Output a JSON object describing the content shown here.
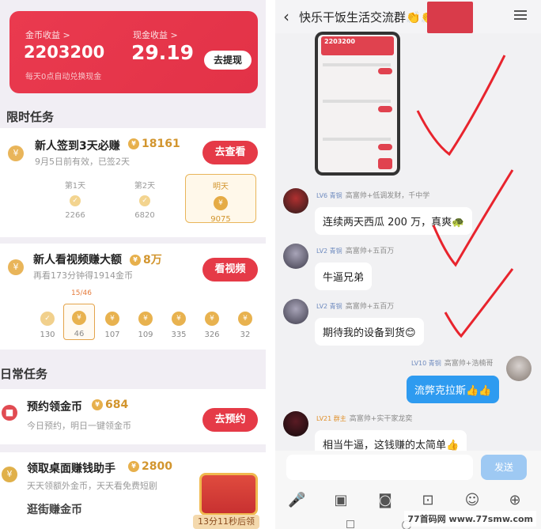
{
  "left": {
    "coin_income_label": "金币收益 >",
    "coin_income_value": "2203200",
    "cash_income_label": "现金收益 >",
    "cash_income_value": "29.19",
    "auto_exchange_note": "每天0点自动兑换现金",
    "withdraw_label": "去提现",
    "limited_tasks_title": "限时任务",
    "daily_tasks_title": "日常任务",
    "signin": {
      "title": "新人签到3天必赚",
      "amount": "18161",
      "subtitle": "9月5日前有效，已签2天",
      "button": "去查看",
      "days": [
        {
          "label": "第1天",
          "value": "2266"
        },
        {
          "label": "第2天",
          "value": "6820"
        },
        {
          "label": "明天",
          "value": "9075"
        }
      ]
    },
    "video": {
      "title": "新人看视频赚大额",
      "amount": "8万",
      "subtitle": "再看173分钟得1914金币",
      "button": "看视频",
      "progress": "15/46",
      "steps": [
        "130",
        "46",
        "107",
        "109",
        "335",
        "326",
        "32"
      ]
    },
    "reserve": {
      "title": "预约领金币",
      "amount": "684",
      "subtitle": "今日预约，明日一键领金币",
      "button": "去预约"
    },
    "desktop": {
      "title": "领取桌面赚钱助手",
      "amount": "2800",
      "subtitle": "天天领额外金币，天天看免费短剧"
    },
    "bottom_partial": "逛街赚金币",
    "timer": "13分11秒后领"
  },
  "right": {
    "title": "快乐干饭生活交流群👏👏",
    "screenshot_value": "2203200",
    "messages": [
      {
        "level": "LV6 青铜",
        "meta": "高富帅+低调发财，千中学",
        "text": "连续两天西瓜 200 万，真爽🐢"
      },
      {
        "level": "LV2 青铜",
        "meta": "高富帅+五百万",
        "text": "牛逼兄弟"
      },
      {
        "level": "LV2 青铜",
        "meta": "高富帅+五百万",
        "text": "期待我的设备到货😊"
      },
      {
        "level": "LV10 青铜",
        "meta": "高富帅+浩楠哥",
        "text": "流弊克拉斯👍👍"
      },
      {
        "level": "LV21 群主",
        "meta": "高富帅+实干家龙奕",
        "text": "相当牛逼，这钱赚的太简单👍"
      }
    ],
    "send_label": "发送"
  },
  "watermark": "77首码网 www.77smw.com",
  "colors": {
    "accent_red": "#e53a47",
    "coin_gold": "#e7b04c",
    "bubble_blue": "#2e9bf0"
  }
}
